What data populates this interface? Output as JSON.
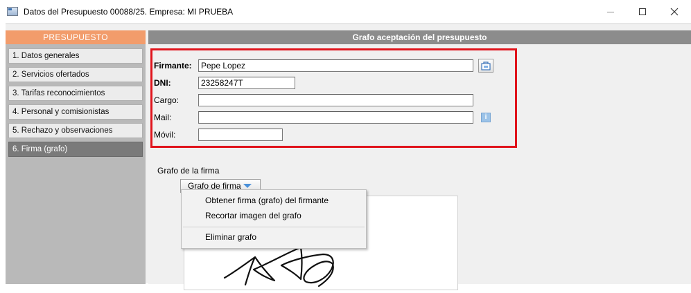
{
  "window": {
    "title": "Datos del Presupuesto 00088/25.  Empresa: MI PRUEBA"
  },
  "sidebar": {
    "header": "PRESUPUESTO",
    "items": [
      {
        "label": "1. Datos generales"
      },
      {
        "label": "2. Servicios ofertados"
      },
      {
        "label": "3. Tarifas reconocimientos"
      },
      {
        "label": "4. Personal y comisionistas"
      },
      {
        "label": "5. Rechazo y observaciones"
      },
      {
        "label": "6. Firma (grafo)",
        "active": true
      }
    ]
  },
  "main": {
    "header": "Grafo aceptación del presupuesto",
    "form": {
      "firmante_label": "Firmante:",
      "firmante_value": "Pepe Lopez",
      "dni_label": "DNI:",
      "dni_value": "23258247T",
      "cargo_label": "Cargo:",
      "cargo_value": "",
      "mail_label": "Mail:",
      "mail_value": "",
      "movil_label": "Móvil:",
      "movil_value": ""
    },
    "grafo_section_label": "Grafo de la firma",
    "grafo_button": {
      "mnemonic": "G",
      "label_rest": "rafo de firma"
    },
    "dropdown_menu": [
      {
        "label": "Obtener firma (grafo) del firmante"
      },
      {
        "label": "Recortar imagen del grafo"
      },
      {
        "label": "Eliminar grafo"
      }
    ]
  },
  "colors": {
    "sidebar_header": "#f29c6b",
    "main_header": "#8c8c8c",
    "highlight_border": "#e0141c",
    "active_item": "#7a7a7a"
  },
  "icons": [
    "app-window-icon",
    "pick-contact-icon",
    "info-icon",
    "dropdown-arrow-icon",
    "minimize-icon",
    "maximize-icon",
    "close-icon"
  ]
}
